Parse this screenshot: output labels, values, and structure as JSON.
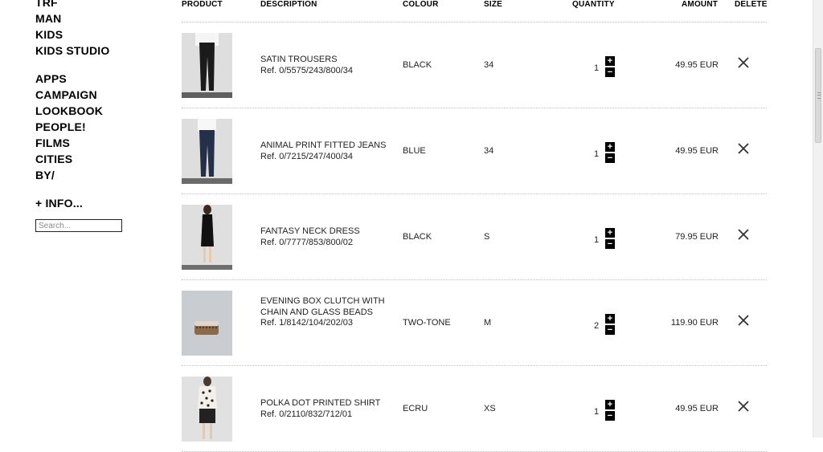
{
  "sidebar": {
    "group1": [
      "TRF",
      "MAN",
      "KIDS",
      "KIDS STUDIO"
    ],
    "group2": [
      "APPS",
      "CAMPAIGN",
      "LOOKBOOK",
      "PEOPLE!",
      "FILMS",
      "CITIES",
      "BY/"
    ],
    "info": "+ INFO...",
    "search_placeholder": "Search..."
  },
  "cart": {
    "headers": {
      "product": "PRODUCT",
      "description": "DESCRIPTION",
      "colour": "COLOUR",
      "size": "SIZE",
      "quantity": "QUANTITY",
      "amount": "AMOUNT",
      "delete": "DELETE"
    },
    "items": [
      {
        "name": "SATIN TROUSERS",
        "name2": "",
        "ref": "Ref. 0/5575/243/800/34",
        "colour": "BLACK",
        "size": "34",
        "quantity": "1",
        "amount": "49.95 EUR",
        "thumb": "trousers-black"
      },
      {
        "name": "ANIMAL PRINT FITTED JEANS",
        "name2": "",
        "ref": "Ref. 0/7215/247/400/34",
        "colour": "BLUE",
        "size": "34",
        "quantity": "1",
        "amount": "49.95 EUR",
        "thumb": "jeans-blue"
      },
      {
        "name": "FANTASY NECK DRESS",
        "name2": "",
        "ref": "Ref. 0/7777/853/800/02",
        "colour": "BLACK",
        "size": "S",
        "quantity": "1",
        "amount": "79.95 EUR",
        "thumb": "dress-black"
      },
      {
        "name": "EVENING BOX CLUTCH WITH",
        "name2": "CHAIN AND GLASS BEADS",
        "ref": "Ref. 1/8142/104/202/03",
        "colour": "TWO-TONE",
        "size": "M",
        "quantity": "2",
        "amount": "119.90 EUR",
        "thumb": "clutch"
      },
      {
        "name": "POLKA DOT PRINTED SHIRT",
        "name2": "",
        "ref": "Ref. 0/2110/832/712/01",
        "colour": "ECRU",
        "size": "XS",
        "quantity": "1",
        "amount": "49.95 EUR",
        "thumb": "polka-shirt"
      }
    ],
    "stepper_plus": "+",
    "stepper_minus": "−"
  },
  "colors": {
    "text": "#111111",
    "divider": "#c2c2c2",
    "thumb_bg": "#e4e4e4"
  }
}
